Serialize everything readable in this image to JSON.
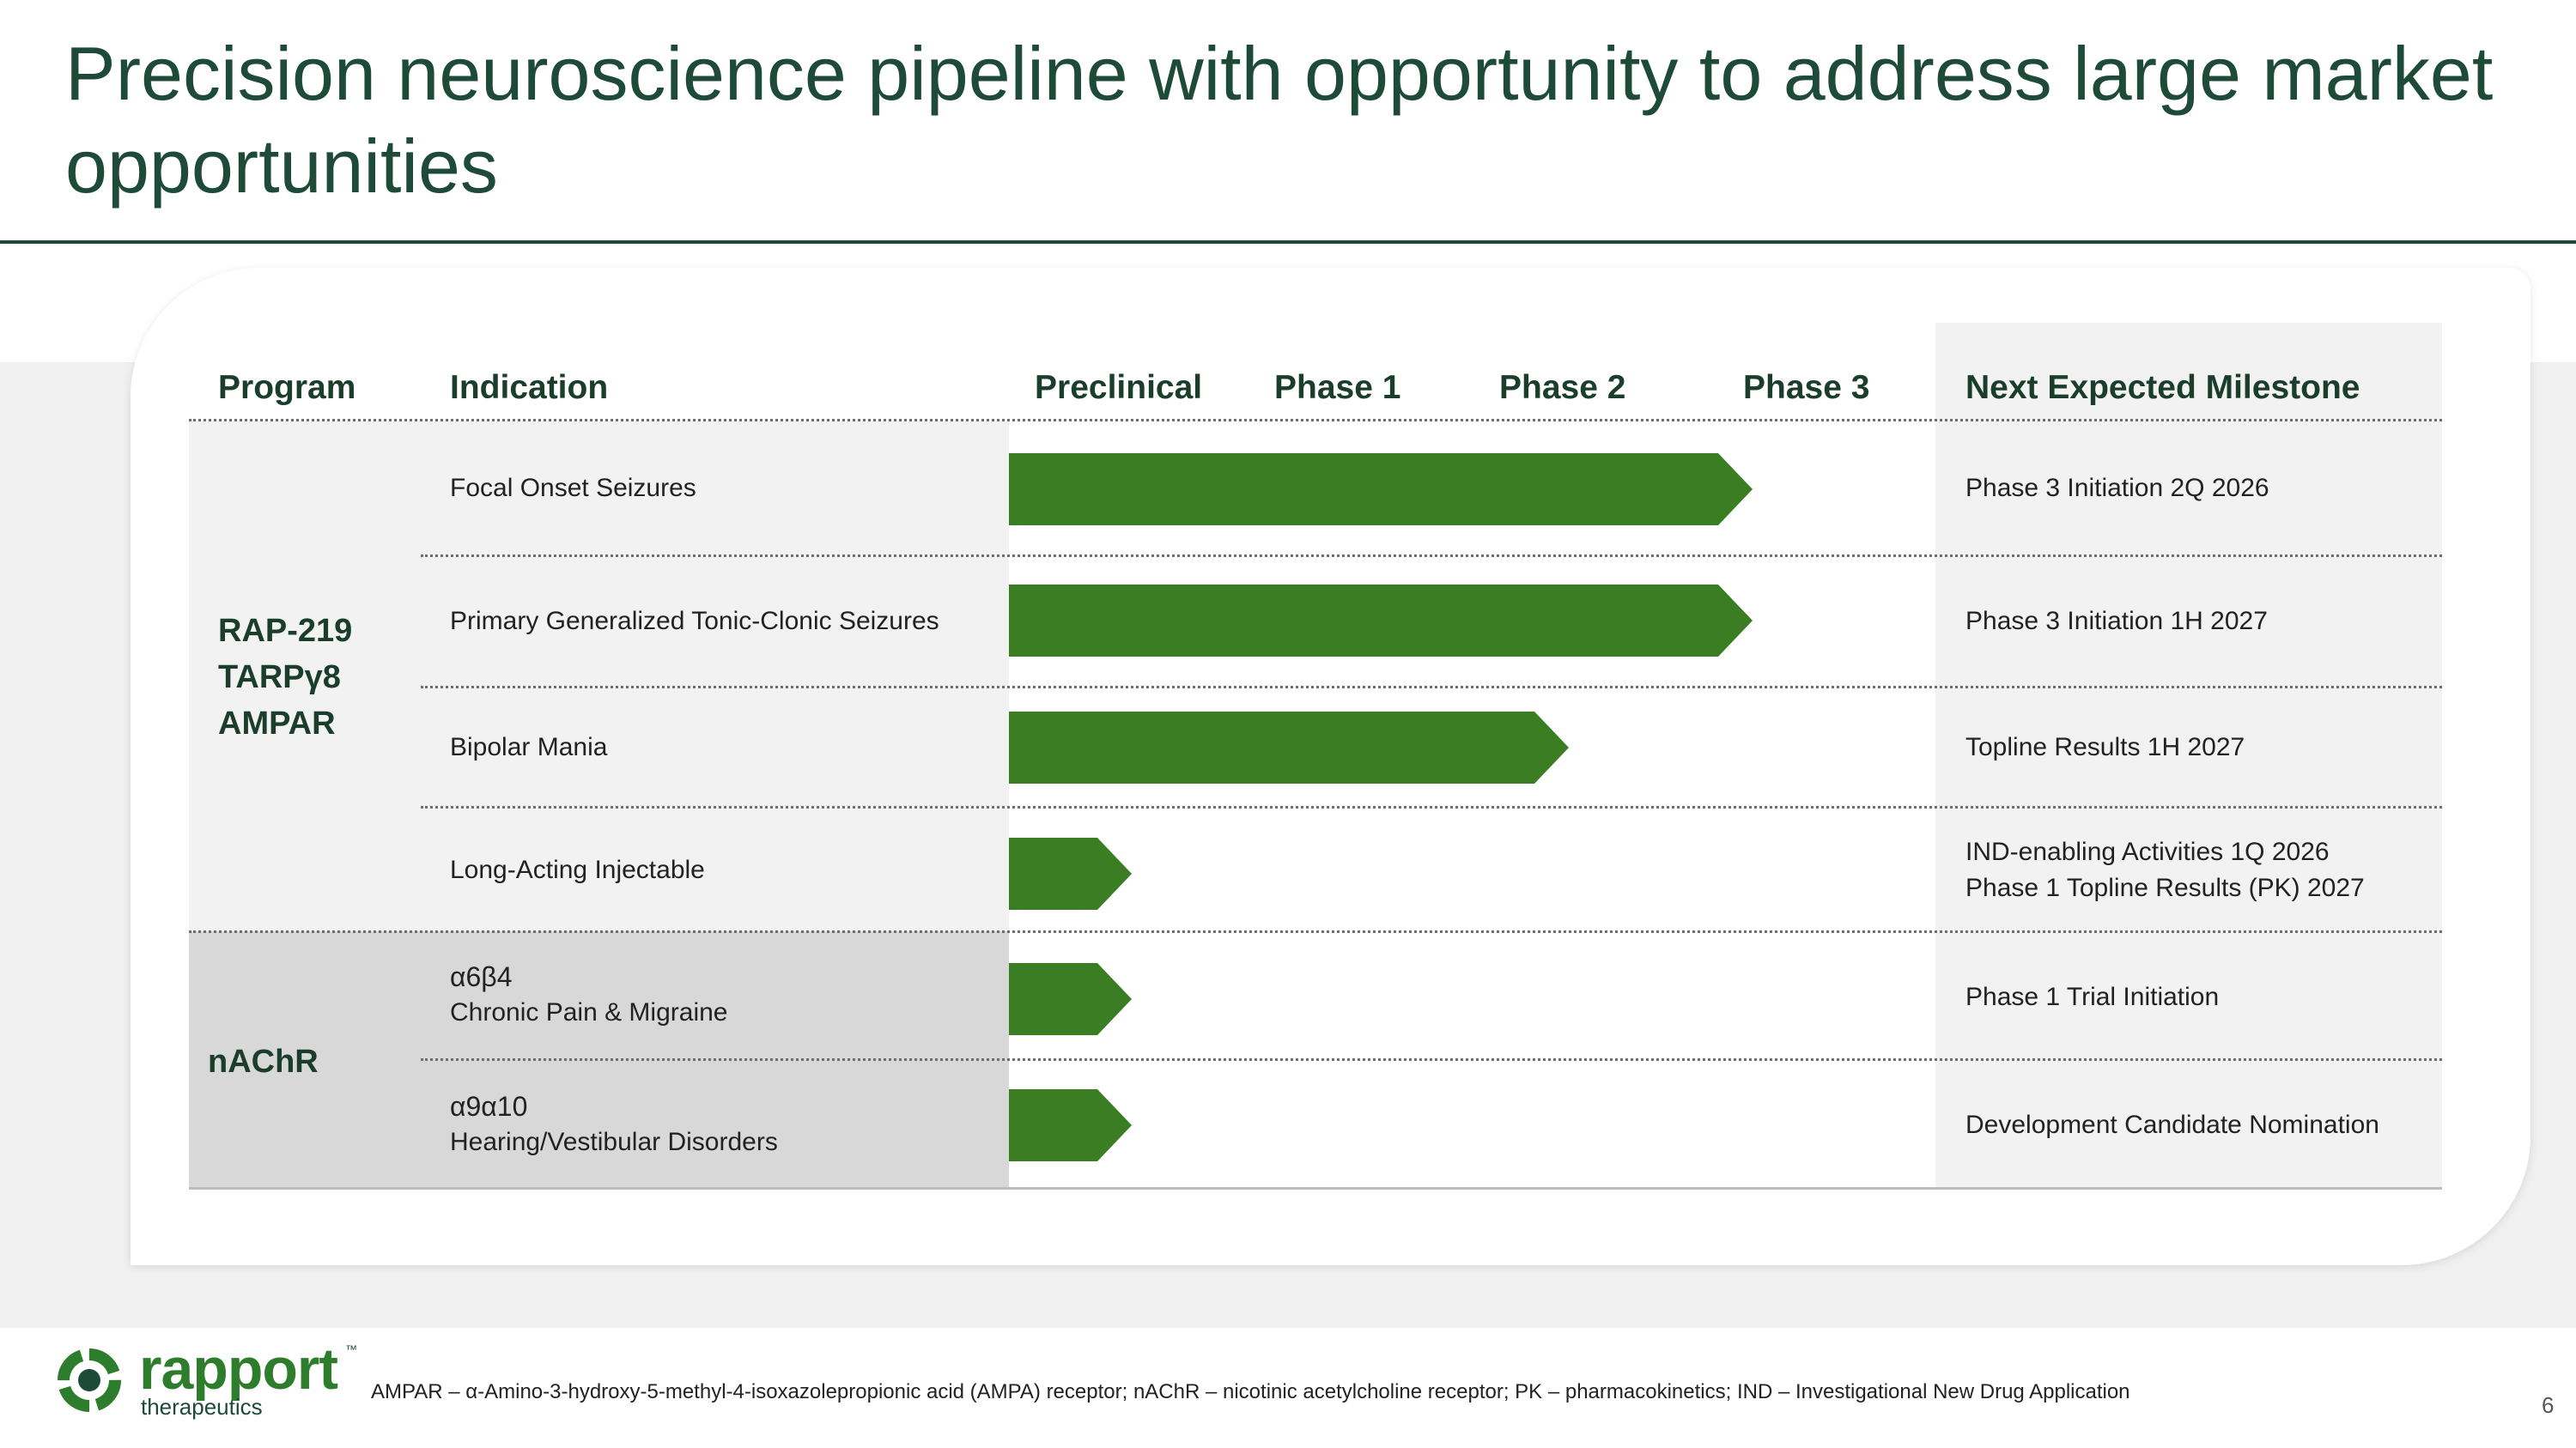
{
  "title": "Precision neuroscience pipeline with opportunity to address large market opportunities",
  "headers": {
    "program": "Program",
    "indication": "Indication",
    "preclinical": "Preclinical",
    "phase1": "Phase 1",
    "phase2": "Phase 2",
    "phase3": "Phase 3",
    "milestone": "Next Expected Milestone"
  },
  "programs": [
    {
      "lines": [
        "RAP-219",
        "TARPγ8",
        "AMPAR"
      ]
    },
    {
      "lines": [
        "nAChR"
      ]
    }
  ],
  "rows": [
    {
      "program": "RAP-219",
      "indication": "Focal Onset Seizures",
      "subtarget": "",
      "stage_progress": "Phase 3",
      "milestone": [
        "Phase 3 Initiation 2Q 2026"
      ]
    },
    {
      "program": "RAP-219",
      "indication": "Primary Generalized Tonic-Clonic Seizures",
      "subtarget": "",
      "stage_progress": "Phase 3",
      "milestone": [
        "Phase 3 Initiation 1H 2027"
      ]
    },
    {
      "program": "RAP-219",
      "indication": "Bipolar Mania",
      "subtarget": "",
      "stage_progress": "Phase 2",
      "milestone": [
        "Topline Results 1H 2027"
      ]
    },
    {
      "program": "RAP-219",
      "indication": "Long-Acting Injectable",
      "subtarget": "",
      "stage_progress": "Preclinical",
      "milestone": [
        "IND-enabling Activities 1Q 2026",
        "Phase 1 Topline Results (PK) 2027"
      ]
    },
    {
      "program": "nAChR",
      "indication": "Chronic Pain & Migraine",
      "subtarget": "α6β4",
      "stage_progress": "Preclinical",
      "milestone": [
        "Phase 1 Trial Initiation"
      ]
    },
    {
      "program": "nAChR",
      "indication": "Hearing/Vestibular Disorders",
      "subtarget": "α9α10",
      "stage_progress": "Preclinical",
      "milestone": [
        "Development Candidate Nomination"
      ]
    }
  ],
  "colors": {
    "bar": "#3a7d22",
    "title": "#1e4a3a",
    "program_band_1": "#f2f2f2",
    "program_band_2": "#d8d8d8"
  },
  "logo": {
    "word": "rapport",
    "sub": "therapeutics",
    "tm": "™",
    "icon": "rapport-logo-icon"
  },
  "footnote": "AMPAR – α-Amino-3-hydroxy-5-methyl-4-isoxazolepropionic acid (AMPA) receptor; nAChR – nicotinic acetylcholine receptor; PK – pharmacokinetics; IND – Investigational New Drug Application",
  "page_number": "6"
}
